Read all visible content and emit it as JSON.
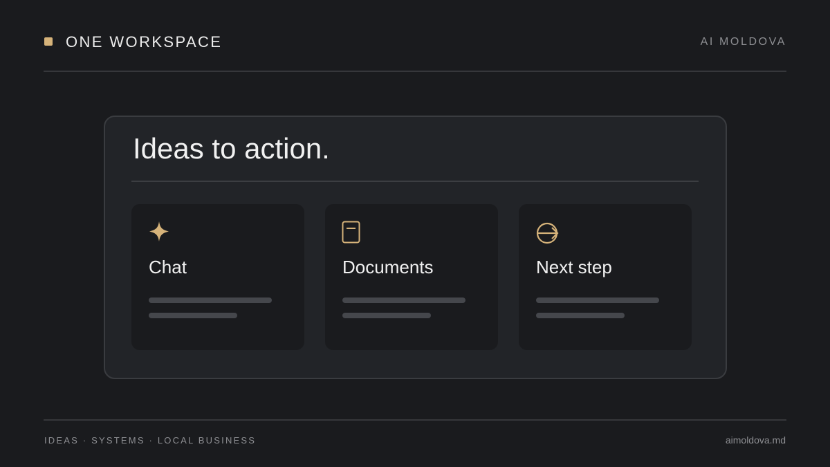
{
  "header": {
    "title": "ONE WORKSPACE",
    "org": "AI MOLDOVA"
  },
  "main": {
    "headline": "Ideas to action.",
    "cards": [
      {
        "icon": "sparkle-icon",
        "label": "Chat"
      },
      {
        "icon": "document-icon",
        "label": "Documents"
      },
      {
        "icon": "arrow-circle-icon",
        "label": "Next step"
      }
    ]
  },
  "footer": {
    "tagline": "IDEAS · SYSTEMS · LOCAL BUSINESS",
    "website": "aimoldova.md"
  },
  "colors": {
    "background": "#1a1b1e",
    "panel": "#222428",
    "accent": "#d6b37a",
    "muted_text": "#8d8e92"
  }
}
